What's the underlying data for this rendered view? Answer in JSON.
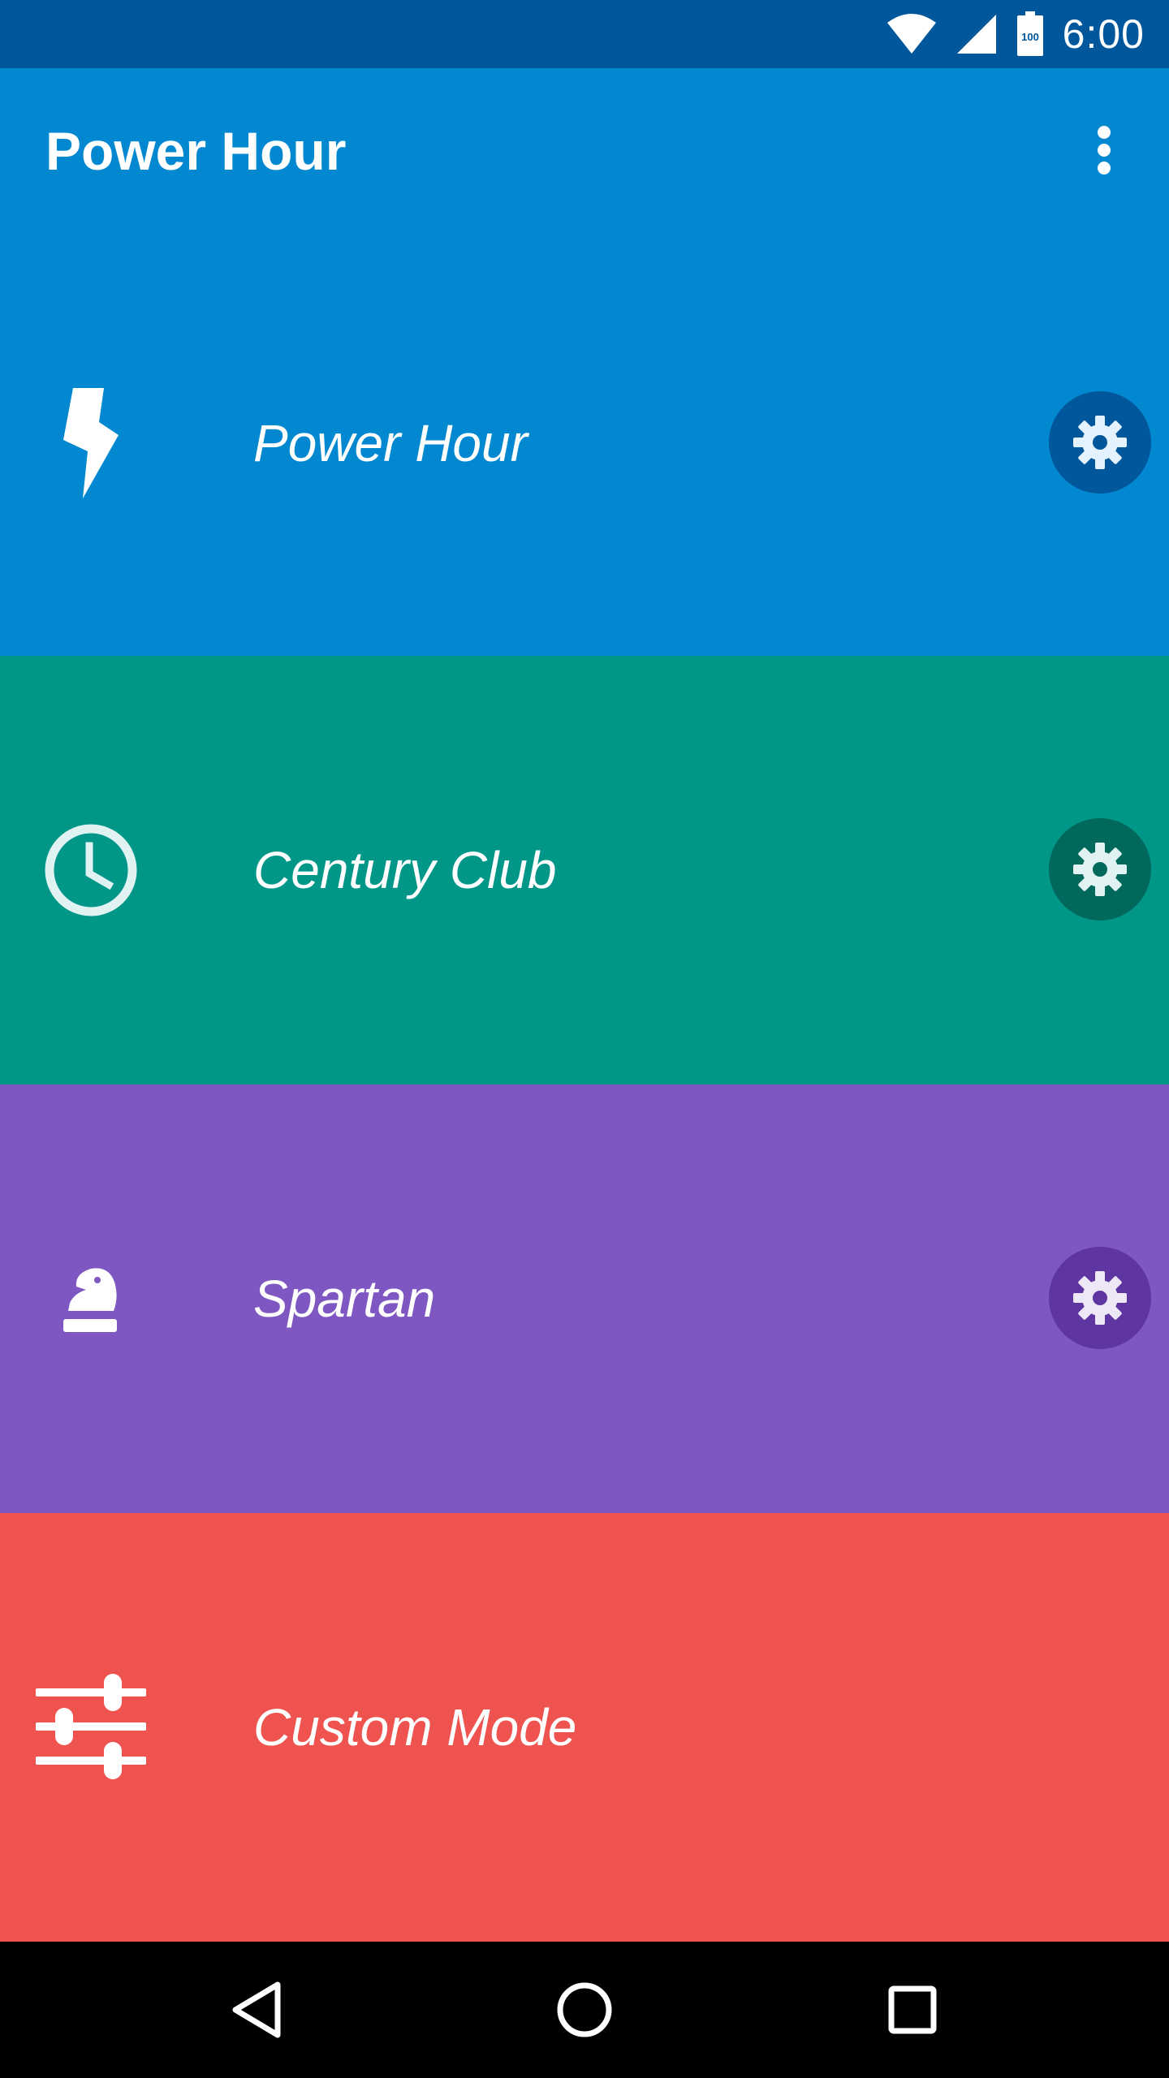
{
  "status_bar": {
    "time": "6:00",
    "battery_level": "100",
    "icons": [
      "wifi-icon",
      "cell-signal-icon",
      "battery-icon"
    ],
    "background": "#01579b"
  },
  "app_bar": {
    "title": "Power Hour",
    "overflow_icon": "more-vert-icon",
    "background": "#0288d1"
  },
  "modes": [
    {
      "label": "Power Hour",
      "icon": "lightning-bolt-icon",
      "background": "#0288d1",
      "settings_icon": "gear-icon",
      "settings_background": "#01579b"
    },
    {
      "label": "Century Club",
      "icon": "clock-icon",
      "background": "#009688",
      "settings_icon": "gear-icon",
      "settings_background": "#00695c"
    },
    {
      "label": "Spartan",
      "icon": "chess-knight-icon",
      "background": "#7e57c2",
      "settings_icon": "gear-icon",
      "settings_background": "#5e35a1"
    },
    {
      "label": "Custom Mode",
      "icon": "tune-sliders-icon",
      "background": "#ef5350"
    }
  ],
  "nav_bar": {
    "buttons": [
      "back-icon",
      "home-icon",
      "recents-icon"
    ]
  }
}
